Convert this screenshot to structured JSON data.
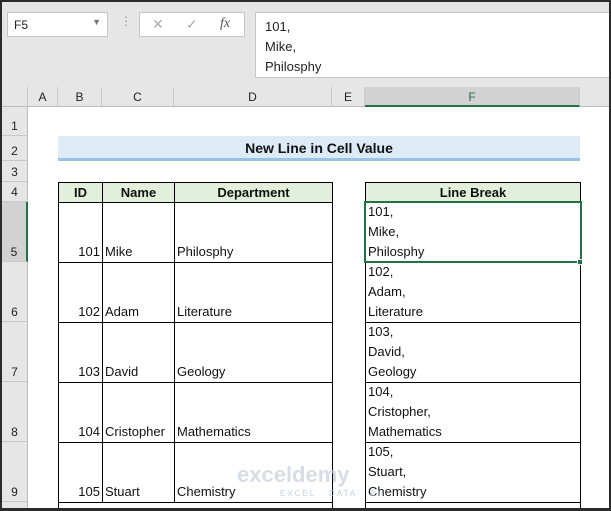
{
  "formula_bar": {
    "name_box": "F5",
    "cancel_icon": "✕",
    "enter_icon": "✓",
    "fx_icon": "fx",
    "content": "101,\nMike,\nPhilosphy"
  },
  "columns": [
    "A",
    "B",
    "C",
    "D",
    "E",
    "F"
  ],
  "rows": [
    "1",
    "2",
    "3",
    "4",
    "5",
    "6",
    "7",
    "8",
    "9"
  ],
  "title": "New Line in Cell Value",
  "table": {
    "headers": [
      "ID",
      "Name",
      "Department"
    ],
    "rows": [
      {
        "id": "101",
        "name": "Mike",
        "dept": "Philosphy"
      },
      {
        "id": "102",
        "name": "Adam",
        "dept": "Literature"
      },
      {
        "id": "103",
        "name": "David",
        "dept": "Geology"
      },
      {
        "id": "104",
        "name": "Cristopher",
        "dept": "Mathematics"
      },
      {
        "id": "105",
        "name": "Stuart",
        "dept": "Chemistry"
      }
    ]
  },
  "line_break": {
    "header": "Line Break",
    "values": [
      "101,\nMike,\nPhilosphy",
      "102,\nAdam,\nLiterature",
      "103,\nDavid,\nGeology",
      "104,\nCristopher,\nMathematics",
      "105,\nStuart,\nChemistry"
    ]
  },
  "watermark": {
    "name": "exceldemy",
    "tagline": "EXCEL · DATA · BI"
  },
  "colors": {
    "accent": "#217346",
    "header_fill": "#e2efda",
    "title_fill": "#ddebf7"
  }
}
